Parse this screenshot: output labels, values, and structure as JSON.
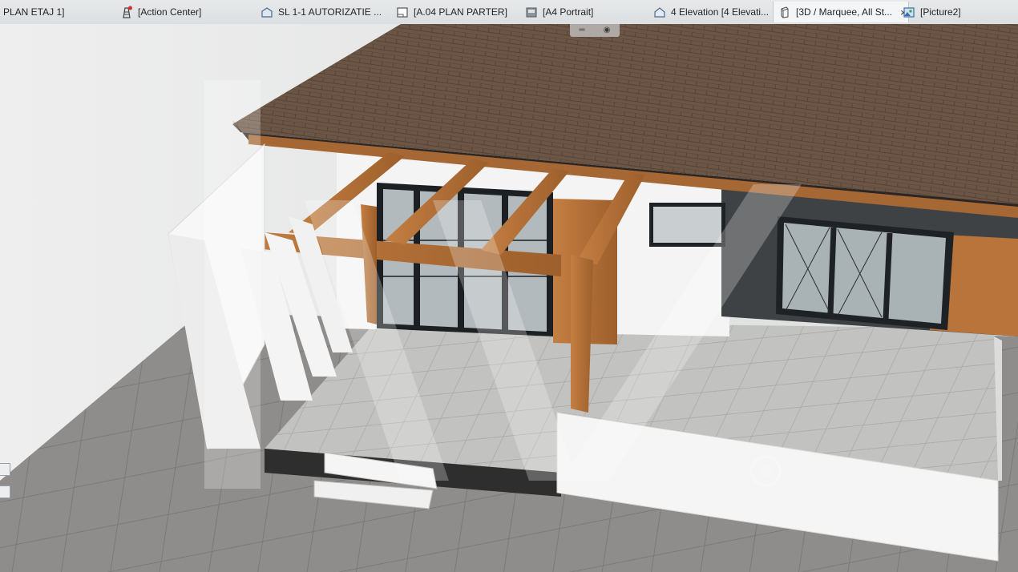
{
  "tabs": [
    {
      "label": "PLAN ETAJ 1]",
      "icon": "none"
    },
    {
      "label": "[Action Center]",
      "icon": "action-center-icon"
    },
    {
      "label": "SL  1-1 AUTORIZATIE ...",
      "icon": "section-icon"
    },
    {
      "label": "[A.04 PLAN PARTER]",
      "icon": "layout-icon"
    },
    {
      "label": "[A4 Portrait]",
      "icon": "master-layout-icon"
    },
    {
      "label": "4 Elevation [4 Elevati...",
      "icon": "elevation-icon"
    },
    {
      "label": "[3D / Marquee, All St...",
      "icon": "3d-view-icon",
      "active": true,
      "close": "×"
    },
    {
      "label": "[Picture2]",
      "icon": "picture-icon"
    }
  ],
  "viewport": {
    "watermark_mark": "®",
    "nav_widget": {
      "left": "═",
      "right": "◉"
    }
  },
  "colors": {
    "roof": "#6b5545",
    "timber": "#b8743a",
    "wall": "#f3f3f3",
    "dark_wall": "#3f4245",
    "floor": "#bdbdbb",
    "ground": "#8d8c8a",
    "accent_red": "#d0312d"
  }
}
